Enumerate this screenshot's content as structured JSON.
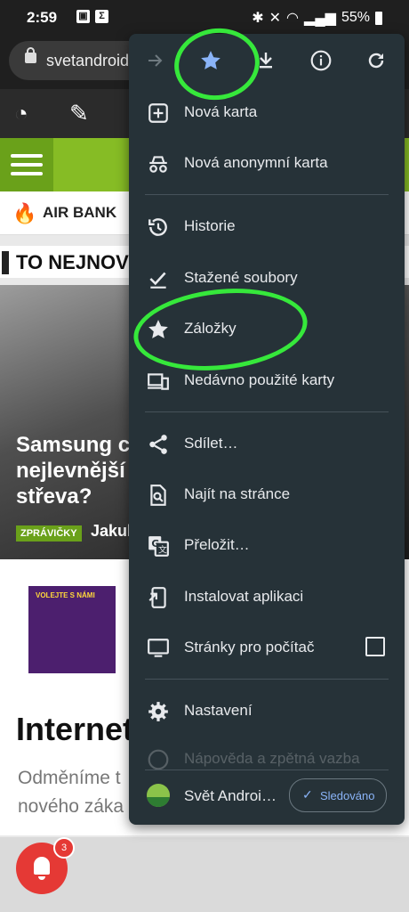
{
  "status_bar": {
    "time": "2:59",
    "battery": "55%"
  },
  "browser": {
    "url": "svetandroid"
  },
  "site": {
    "ticker_text": "AIR BANK",
    "section_title": "TO NEJNOV",
    "hero_headline_lines": [
      "Samsung c",
      "nejlevnější",
      "střeva?"
    ],
    "hero_tag": "ZPRÁVIČKY",
    "hero_author": "Jakul",
    "ad_text": "VOLEJTE S NÁMI",
    "article_title": "Internet",
    "article_snippet_lines": [
      "Odměníme t",
      "nového záka"
    ],
    "notification_count": "3"
  },
  "menu": {
    "top_icons": [
      "forward-icon",
      "star-icon",
      "download-icon",
      "info-icon",
      "refresh-icon"
    ],
    "items": [
      {
        "label": "Nová karta",
        "icon": "new-tab-icon"
      },
      {
        "label": "Nová anonymní karta",
        "icon": "incognito-icon"
      },
      {
        "label": "Historie",
        "icon": "history-icon"
      },
      {
        "label": "Stažené soubory",
        "icon": "downloads-icon"
      },
      {
        "label": "Záložky",
        "icon": "bookmarks-icon"
      },
      {
        "label": "Nedávno použité karty",
        "icon": "recent-tabs-icon"
      },
      {
        "label": "Sdílet…",
        "icon": "share-icon"
      },
      {
        "label": "Najít na stránce",
        "icon": "find-in-page-icon"
      },
      {
        "label": "Přeložit…",
        "icon": "translate-icon"
      },
      {
        "label": "Instalovat aplikaci",
        "icon": "install-app-icon"
      },
      {
        "label": "Stránky pro počítač",
        "icon": "desktop-site-icon"
      },
      {
        "label": "Nastavení",
        "icon": "settings-icon"
      },
      {
        "label": "Nápověda a zpětná vazba",
        "icon": "help-icon"
      }
    ],
    "follow": {
      "site_name": "Svět Androi…",
      "button_label": "Sledováno"
    }
  },
  "colors": {
    "menu_bg": "#263238",
    "accent_blue": "#8ab4f8",
    "highlight_green": "#36e83b",
    "site_green": "#86bc25"
  }
}
